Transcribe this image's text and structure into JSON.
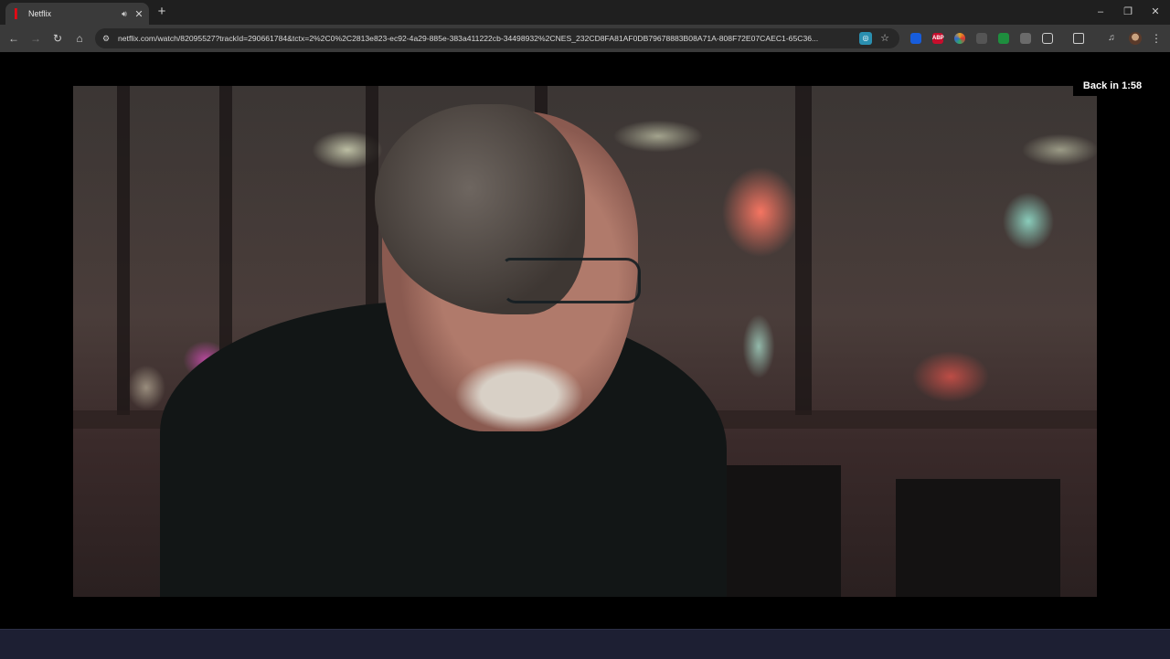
{
  "browser": {
    "tab": {
      "title": "Netflix",
      "favicon": "netflix-icon",
      "audio_icon": "speaker-icon",
      "close_icon": "close-icon",
      "brand_color": "#e50914"
    },
    "new_tab_icon": "plus-icon",
    "window_controls": {
      "minimize": "–",
      "restore": "❐",
      "close": "✕"
    },
    "nav": {
      "back": "←",
      "forward": "→",
      "reload": "↻",
      "home": "⌂"
    },
    "address_bar": {
      "url": "netflix.com/watch/82095527?trackId=290661784&tctx=2%2C0%2C2813e823-ec92-4a29-885e-383a411222cb-34498932%2CNES_232CD8FA81AF0DB79678883B08A71A-808F72E07CAEC1-65C36...",
      "site_info_icon": "tune-icon",
      "lens_icon": "lens-icon",
      "bookmark_icon": "star-icon"
    },
    "extensions": [
      {
        "name": "bitwarden-icon",
        "label": "",
        "color": "#175ddc"
      },
      {
        "name": "adblock-plus-icon",
        "label": "ABP",
        "color": "#c70d2c"
      },
      {
        "name": "color-wheel-icon",
        "label": "",
        "color": "#e3a324"
      },
      {
        "name": "vpn-icon",
        "label": "",
        "color": "#555555"
      },
      {
        "name": "sheets-icon",
        "label": "",
        "color": "#1e8e3e"
      },
      {
        "name": "translate-icon",
        "label": "",
        "color": "#6b6b6b"
      },
      {
        "name": "puzzle-icon",
        "label": "",
        "color": "#3a3a3a"
      }
    ],
    "menu_icon": "⋮"
  },
  "player": {
    "back_label": "Back in 1:58",
    "accent": "#ffffff"
  }
}
